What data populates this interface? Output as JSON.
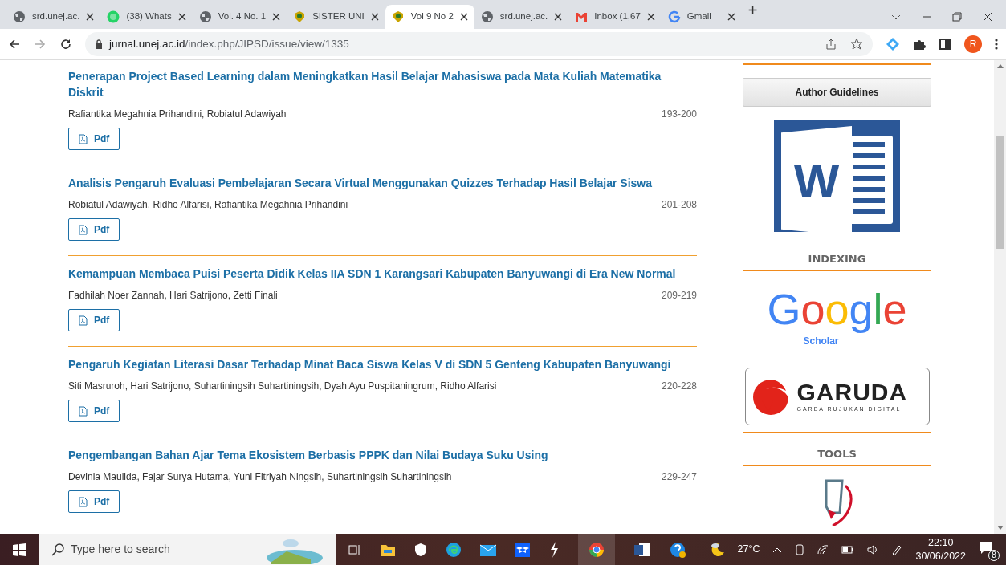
{
  "browser": {
    "tabs": [
      {
        "label": "srd.unej.ac.",
        "kind": "globe",
        "selected": false
      },
      {
        "label": "(38) Whats",
        "kind": "chat",
        "selected": false
      },
      {
        "label": "Vol. 4 No. 1",
        "kind": "globe",
        "selected": false
      },
      {
        "label": "SISTER UNI",
        "kind": "emblem",
        "selected": false
      },
      {
        "label": "Vol 9 No 2",
        "kind": "emblem",
        "selected": true
      },
      {
        "label": "srd.unej.ac.",
        "kind": "globe",
        "selected": false
      },
      {
        "label": "Inbox (1,67",
        "kind": "mail",
        "selected": false
      },
      {
        "label": "Gmail",
        "kind": "g",
        "selected": false
      }
    ],
    "new_tab": "+",
    "address": {
      "host": "jurnal.unej.ac.id",
      "path": "/index.php/JIPSD/issue/view/1335"
    },
    "profile": "R"
  },
  "articles": [
    {
      "title": "Penerapan Project Based Learning dalam Meningkatkan Hasil Belajar Mahasiswa pada Mata Kuliah Matematika Diskrit",
      "authors": "Rafiantika Megahnia Prihandini, Robiatul Adawiyah",
      "pages": "193-200",
      "button": "Pdf"
    },
    {
      "title": "Analisis Pengaruh Evaluasi Pembelajaran Secara Virtual Menggunakan Quizzes Terhadap Hasil Belajar Siswa",
      "authors": "Robiatul Adawiyah, Ridho Alfarisi, Rafiantika Megahnia Prihandini",
      "pages": "201-208",
      "button": "Pdf"
    },
    {
      "title": "Kemampuan Membaca Puisi Peserta Didik Kelas IIA SDN 1 Karangsari Kabupaten Banyuwangi di Era New Normal",
      "authors": "Fadhilah Noer Zannah, Hari Satrijono, Zetti Finali",
      "pages": "209-219",
      "button": "Pdf"
    },
    {
      "title": "Pengaruh Kegiatan Literasi Dasar Terhadap Minat Baca Siswa Kelas V di SDN 5 Genteng Kabupaten Banyuwangi",
      "authors": "Siti Masruroh, Hari Satrijono, Suhartiningsih Suhartiningsih, Dyah Ayu Puspitaningrum, Ridho Alfarisi",
      "pages": "220-228",
      "button": "Pdf"
    },
    {
      "title": "Pengembangan Bahan Ajar Tema Ekosistem Berbasis PPPK dan Nilai Budaya Suku Using",
      "authors": "Devinia Maulida, Fajar Surya Hutama, Yuni Fitriyah Ningsih, Suhartiningsih Suhartiningsih",
      "pages": "229-247",
      "button": "Pdf"
    }
  ],
  "sidebar": {
    "guidelines_button": "Author Guidelines",
    "word_letter": "W",
    "indexing_heading": "INDEXING",
    "google_word": "Google",
    "scholar_word": "Scholar",
    "garuda_name": "GARUDA",
    "garuda_tagline": "GARBA RUJUKAN DIGITAL",
    "tools_heading": "TOOLS"
  },
  "taskbar": {
    "search_placeholder": "Type here to search",
    "temperature": "27°C",
    "time": "22:10",
    "date": "30/06/2022",
    "notifications": "8"
  }
}
